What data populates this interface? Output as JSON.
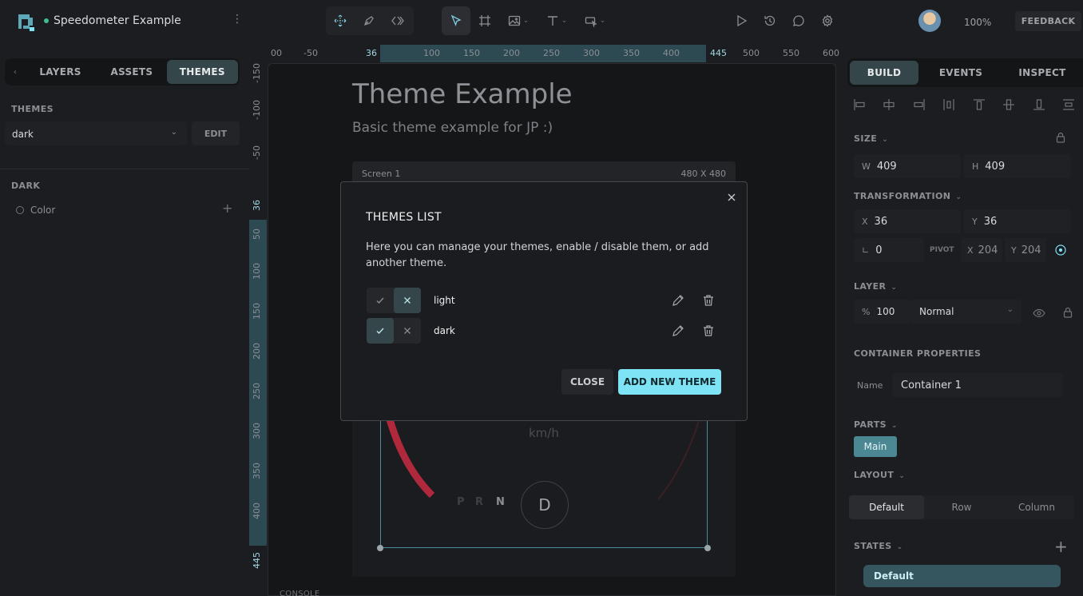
{
  "app": {
    "project_name": "Speedometer Example",
    "zoom": "100%",
    "feedback_label": "FEEDBACK",
    "menu_icon": "kebab-icon",
    "toolbar_icons": [
      "move-grid-icon",
      "pen-icon",
      "code-icon",
      "pointer-icon",
      "frame-icon",
      "image-icon",
      "text-icon",
      "component-icon",
      "play-icon",
      "history-icon",
      "comment-icon",
      "settings-icon"
    ]
  },
  "left_panel": {
    "tabs": [
      "LAYERS",
      "ASSETS",
      "THEMES"
    ],
    "active_tab": "THEMES",
    "themes_title": "THEMES",
    "selected_theme": "dark",
    "edit_label": "EDIT",
    "section_title": "DARK",
    "color_label": "Color"
  },
  "rulers": {
    "h_ticks": [
      "00",
      "-50",
      "36",
      "100",
      "150",
      "200",
      "250",
      "300",
      "350",
      "400",
      "445",
      "500",
      "550",
      "600"
    ],
    "v_ticks": [
      "-150",
      "-100",
      "-50",
      "36",
      "50",
      "100",
      "150",
      "200",
      "250",
      "300",
      "350",
      "400",
      "445"
    ]
  },
  "canvas": {
    "title": "Theme Example",
    "subtitle": "Basic theme example for JP :)",
    "screen_name": "Screen 1",
    "screen_size": "480 X 480",
    "unit": "km/h",
    "gears": [
      "P",
      "R",
      "N"
    ],
    "current_gear": "D",
    "console_label": "CONSOLE"
  },
  "modal": {
    "title": "THEMES LIST",
    "description": "Here you can manage your themes, enable / disable them, or add another theme.",
    "themes": [
      {
        "name": "light",
        "enabled": false
      },
      {
        "name": "dark",
        "enabled": true
      }
    ],
    "close_label": "CLOSE",
    "add_label": "ADD NEW THEME"
  },
  "right_panel": {
    "tabs": [
      "BUILD",
      "EVENTS",
      "INSPECT"
    ],
    "active_tab": "BUILD",
    "size_title": "SIZE",
    "w_label": "W",
    "w_value": "409",
    "h_label": "H",
    "h_value": "409",
    "transform_title": "TRANSFORMATION",
    "x_label": "X",
    "x_value": "36",
    "y_label": "Y",
    "y_value": "36",
    "angle_label": "∟",
    "angle_value": "0",
    "pivot_label": "PIVOT",
    "pivot_x": "204",
    "pivot_y": "204",
    "layer_title": "LAYER",
    "opacity_label": "%",
    "opacity_value": "100",
    "blend_mode": "Normal",
    "container_title": "CONTAINER PROPERTIES",
    "name_label": "Name",
    "name_value": "Container 1",
    "parts_title": "PARTS",
    "part_main": "Main",
    "layout_title": "LAYOUT",
    "layout_options": [
      "Default",
      "Row",
      "Column"
    ],
    "layout_selected": "Default",
    "states_title": "STATES",
    "state_default": "Default"
  },
  "colors": {
    "accent": "#7ee3f5",
    "active_tab": "#35464a",
    "gauge_red": "#b0283c",
    "status_dot": "#3fbf8f"
  }
}
